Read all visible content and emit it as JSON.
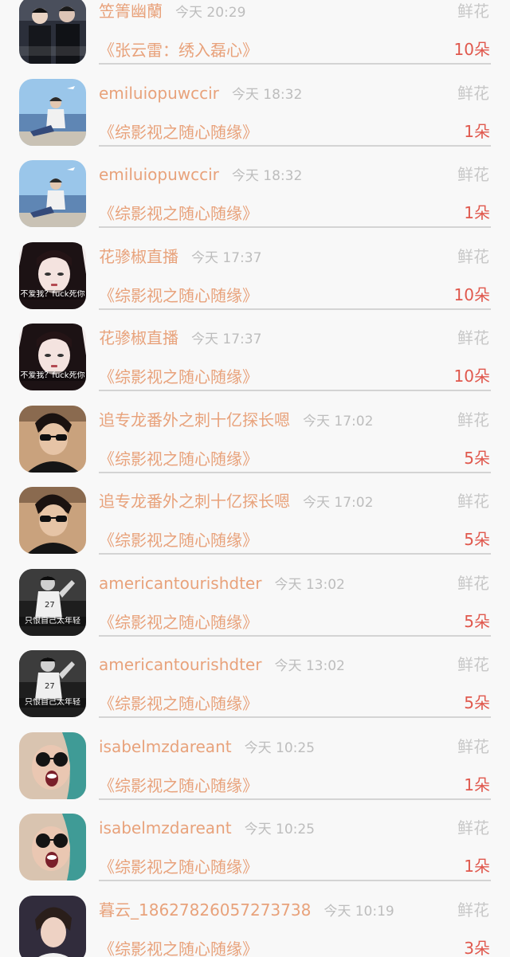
{
  "rows": [
    {
      "name": "笠箐幽蘭",
      "time": "今天 20:29",
      "type": "鲜花",
      "book": "《张云雷：绣入磊心》",
      "count": "10朵",
      "avatar": "avatar-couple",
      "caption": ""
    },
    {
      "name": "emiluiopuwccir",
      "time": "今天 18:32",
      "type": "鲜花",
      "book": "《综影视之随心随缘》",
      "count": "1朵",
      "avatar": "avatar-beach",
      "caption": ""
    },
    {
      "name": "emiluiopuwccir",
      "time": "今天 18:32",
      "type": "鲜花",
      "book": "《综影视之随心随缘》",
      "count": "1朵",
      "avatar": "avatar-beach",
      "caption": ""
    },
    {
      "name": "花骖椒直播",
      "time": "今天 17:37",
      "type": "鲜花",
      "book": "《综影视之随心随缘》",
      "count": "10朵",
      "avatar": "avatar-girl",
      "caption": "不爱我？fuck死你"
    },
    {
      "name": "花骖椒直播",
      "time": "今天 17:37",
      "type": "鲜花",
      "book": "《综影视之随心随缘》",
      "count": "10朵",
      "avatar": "avatar-girl",
      "caption": "不爱我？fuck死你"
    },
    {
      "name": "追专龙番外之刺十亿探长嗯",
      "time": "今天 17:02",
      "type": "鲜花",
      "book": "《综影视之随心随缘》",
      "count": "5朵",
      "avatar": "avatar-sunglasses",
      "caption": ""
    },
    {
      "name": "追专龙番外之刺十亿探长嗯",
      "time": "今天 17:02",
      "type": "鲜花",
      "book": "《综影视之随心随缘》",
      "count": "5朵",
      "avatar": "avatar-sunglasses",
      "caption": ""
    },
    {
      "name": "americantourishdter",
      "time": "今天 13:02",
      "type": "鲜花",
      "book": "《综影视之随心随缘》",
      "count": "5朵",
      "avatar": "avatar-bw",
      "caption": "只恨自己太年轻"
    },
    {
      "name": "americantourishdter",
      "time": "今天 13:02",
      "type": "鲜花",
      "book": "《综影视之随心随缘》",
      "count": "5朵",
      "avatar": "avatar-bw",
      "caption": "只恨自己太年轻"
    },
    {
      "name": "isabelmzdareant",
      "time": "今天 10:25",
      "type": "鲜花",
      "book": "《综影视之随心随缘》",
      "count": "1朵",
      "avatar": "avatar-scream",
      "caption": ""
    },
    {
      "name": "isabelmzdareant",
      "time": "今天 10:25",
      "type": "鲜花",
      "book": "《综影视之随心随缘》",
      "count": "1朵",
      "avatar": "avatar-scream",
      "caption": ""
    },
    {
      "name": "暮云_18627826057273738",
      "time": "今天 10:19",
      "type": "鲜花",
      "book": "《综影视之随心随缘》",
      "count": "3朵",
      "avatar": "avatar-idol",
      "caption": ""
    }
  ]
}
